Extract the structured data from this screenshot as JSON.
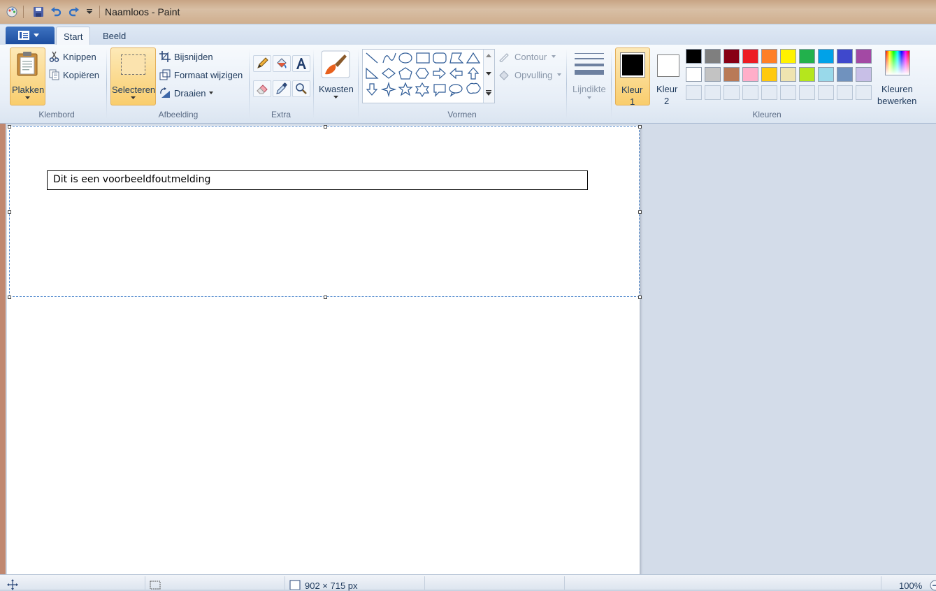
{
  "window": {
    "title": "Naamloos - Paint"
  },
  "tabs": [
    {
      "label": "Start"
    },
    {
      "label": "Beeld"
    }
  ],
  "ribbon": {
    "klembord": {
      "group_label": "Klembord",
      "paste": "Plakken",
      "cut": "Knippen",
      "copy": "Kopiëren"
    },
    "afbeelding": {
      "group_label": "Afbeelding",
      "select": "Selecteren",
      "crop": "Bijsnijden",
      "resize": "Formaat wijzigen",
      "rotate": "Draaien"
    },
    "extra": {
      "group_label": "Extra"
    },
    "brushes": {
      "label": "Kwasten"
    },
    "vormen": {
      "group_label": "Vormen",
      "outline": "Contour",
      "fill": "Opvulling"
    },
    "linewidth": {
      "label": "Lijndikte"
    },
    "kleuren": {
      "group_label": "Kleuren",
      "color1_line1": "Kleur",
      "color1_line2": "1",
      "color2_line1": "Kleur",
      "color2_line2": "2",
      "edit_line1": "Kleuren",
      "edit_line2": "bewerken",
      "color1_value": "#000000",
      "color2_value": "#ffffff",
      "palette_row1": [
        "#000000",
        "#7f7f7f",
        "#880015",
        "#ed1c24",
        "#ff7f27",
        "#fff200",
        "#22b14c",
        "#00a2e8",
        "#3f48cc",
        "#a349a4"
      ],
      "palette_row2": [
        "#ffffff",
        "#c3c3c3",
        "#b97a57",
        "#ffaec9",
        "#ffc90e",
        "#efe4b0",
        "#b5e61d",
        "#99d9ea",
        "#7092be",
        "#c8bfe7"
      ]
    }
  },
  "canvas": {
    "message": "Dit is een voorbeeldfoutmelding"
  },
  "statusbar": {
    "size": "902 × 715 px",
    "zoom": "100%"
  }
}
